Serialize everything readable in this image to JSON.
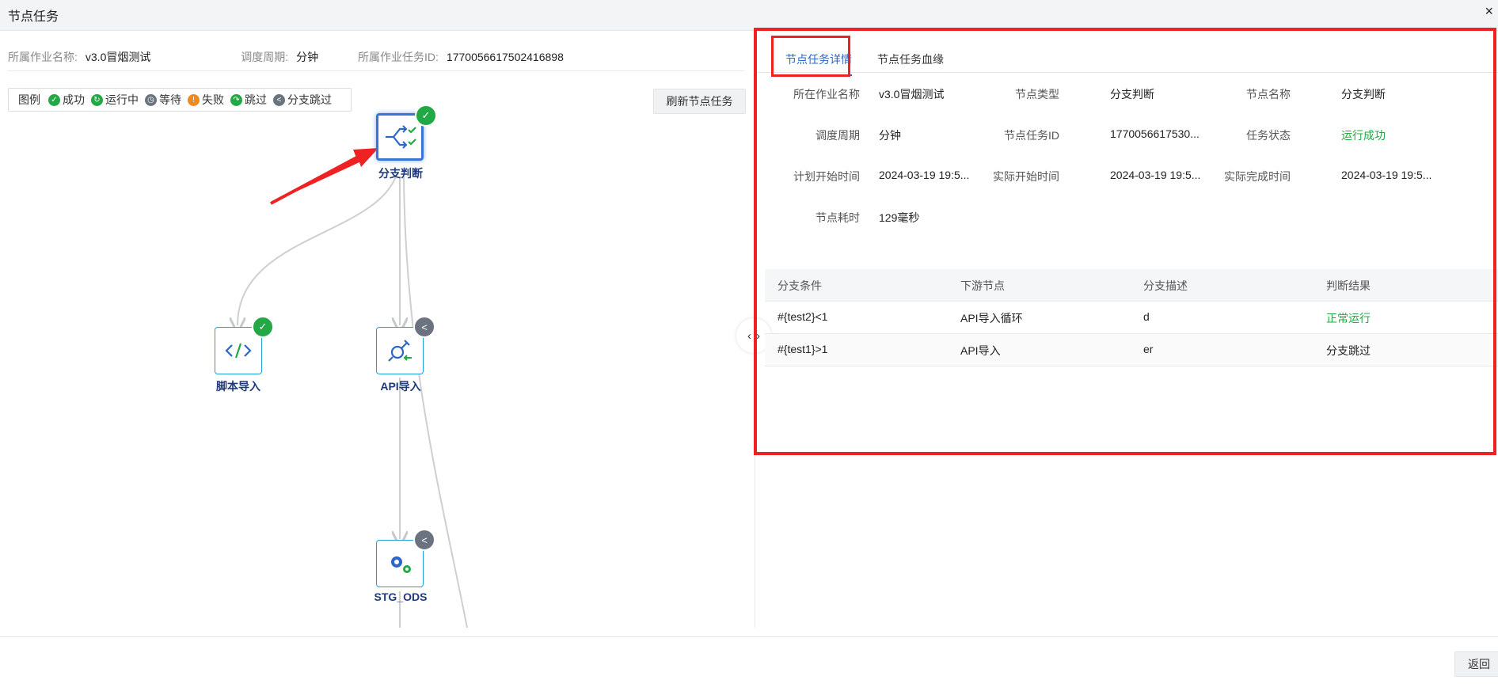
{
  "window": {
    "title": "节点任务",
    "close_glyph": "×"
  },
  "info": {
    "job_name_label": "所属作业名称:",
    "job_name_value": "v3.0冒烟测试",
    "cycle_label": "调度周期:",
    "cycle_value": "分钟",
    "task_id_label": "所属作业任务ID:",
    "task_id_value": "1770056617502416898"
  },
  "legend": {
    "title": "图例",
    "items": [
      {
        "label": "成功",
        "color": "#22a845",
        "icon": "check-icon"
      },
      {
        "label": "运行中",
        "color": "#22a845",
        "icon": "refresh-icon"
      },
      {
        "label": "等待",
        "color": "#6b7280",
        "icon": "clock-icon"
      },
      {
        "label": "失败",
        "color": "#f08a1e",
        "icon": "exclamation-icon"
      },
      {
        "label": "跳过",
        "color": "#22a845",
        "icon": "skip-arrow-icon"
      },
      {
        "label": "分支跳过",
        "color": "#6b7280",
        "icon": "branch-icon"
      }
    ]
  },
  "refresh_button": "刷新节点任务",
  "nodes": [
    {
      "label": "分支判断",
      "icon": "branch-decision-icon",
      "status": "success"
    },
    {
      "label": "脚本导入",
      "icon": "code-icon",
      "status": "success"
    },
    {
      "label": "API导入",
      "icon": "api-plug-icon",
      "status": "branch-skipped"
    },
    {
      "label": "STG_ODS",
      "icon": "gears-icon",
      "status": "branch-skipped"
    }
  ],
  "tabs": [
    {
      "label": "节点任务详情",
      "active": true
    },
    {
      "label": "节点任务血缘",
      "active": false
    }
  ],
  "details": {
    "job_name_label": "所在作业名称",
    "job_name_value": "v3.0冒烟测试",
    "node_type_label": "节点类型",
    "node_type_value": "分支判断",
    "node_name_label": "节点名称",
    "node_name_value": "分支判断",
    "cycle_label": "调度周期",
    "cycle_value": "分钟",
    "node_task_id_label": "节点任务ID",
    "node_task_id_value": "1770056617530...",
    "task_status_label": "任务状态",
    "task_status_value": "运行成功",
    "plan_start_label": "计划开始时间",
    "plan_start_value": "2024-03-19 19:5...",
    "actual_start_label": "实际开始时间",
    "actual_start_value": "2024-03-19 19:5...",
    "actual_end_label": "实际完成时间",
    "actual_end_value": "2024-03-19 19:5...",
    "duration_label": "节点耗时",
    "duration_value": "129毫秒"
  },
  "branch_table": {
    "headers": [
      "分支条件",
      "下游节点",
      "分支描述",
      "判断结果"
    ],
    "rows": [
      {
        "condition": "#{test2}<1",
        "downstream": "API导入循环",
        "desc": "d",
        "result": "正常运行"
      },
      {
        "condition": "#{test1}>1",
        "downstream": "API导入",
        "desc": "er",
        "result": "分支跳过"
      }
    ]
  },
  "colors": {
    "accent": "#2b66c9",
    "success": "#22a845",
    "annotation": "#ee2222"
  },
  "footer": {
    "back_button": "返回"
  }
}
